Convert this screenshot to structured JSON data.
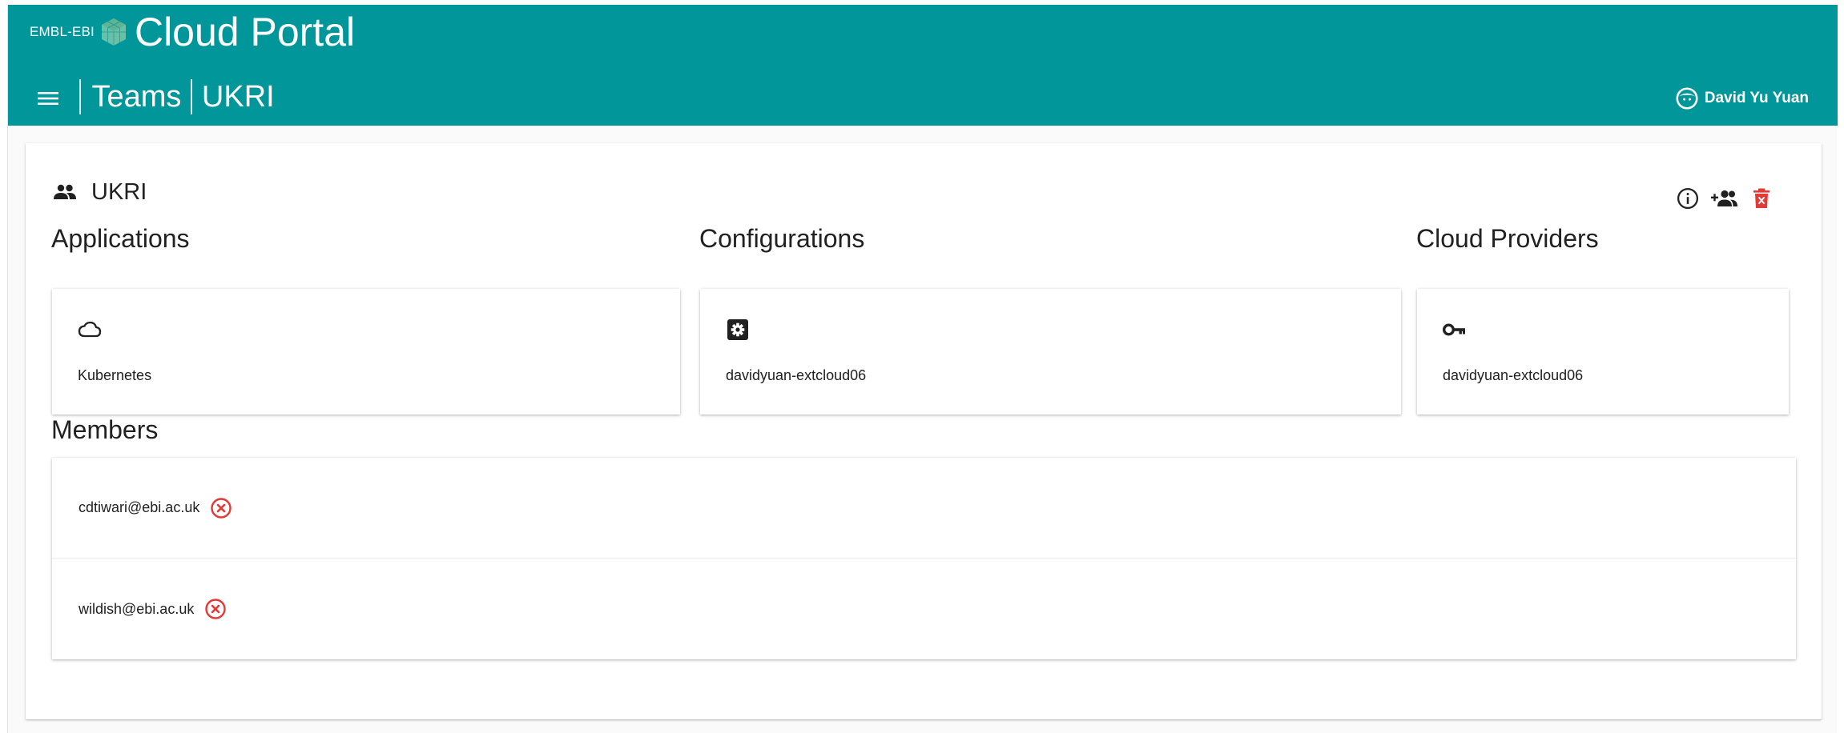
{
  "header": {
    "org": "EMBL-EBI",
    "app_title": "Cloud Portal",
    "breadcrumbs": [
      "Teams",
      "UKRI"
    ],
    "user_name": "David Yu Yuan",
    "bg_color": "#00969a"
  },
  "team": {
    "name": "UKRI",
    "actions": [
      {
        "icon": "info-icon"
      },
      {
        "icon": "add-member-icon"
      },
      {
        "icon": "delete-icon",
        "color": "#e53935"
      }
    ]
  },
  "sections": {
    "applications": {
      "label": "Applications",
      "items": [
        {
          "icon": "cloud-icon",
          "name": "Kubernetes"
        }
      ]
    },
    "configurations": {
      "label": "Configurations",
      "items": [
        {
          "icon": "settings-icon",
          "name": "davidyuan-extcloud06"
        }
      ]
    },
    "cloud_providers": {
      "label": "Cloud Providers",
      "items": [
        {
          "icon": "key-icon",
          "name": "davidyuan-extcloud06"
        }
      ]
    },
    "members": {
      "label": "Members",
      "items": [
        {
          "email": "cdtiwari@ebi.ac.uk"
        },
        {
          "email": "wildish@ebi.ac.uk"
        }
      ]
    }
  },
  "colors": {
    "accent": "#00969a",
    "danger": "#e53935"
  }
}
